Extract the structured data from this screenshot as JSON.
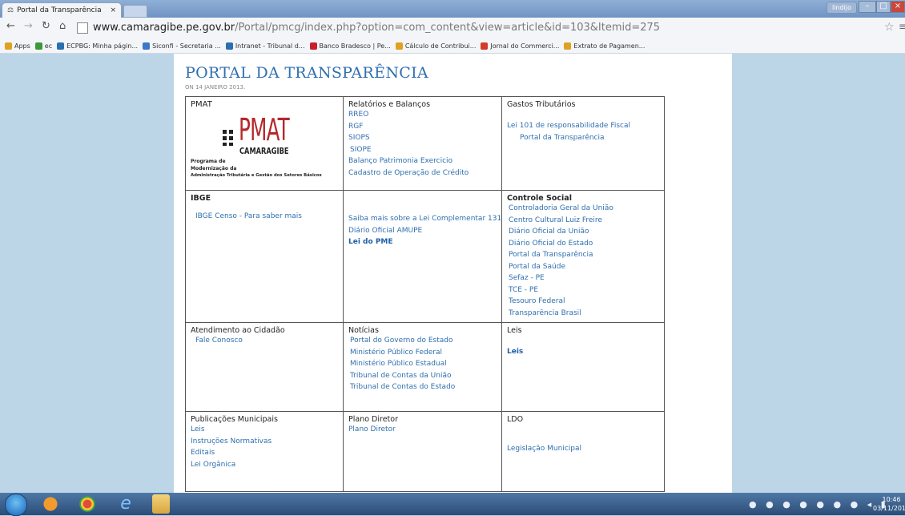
{
  "browser": {
    "tab_title": "Portal da Transparência",
    "tab_close": "×",
    "user_button": "lindijo",
    "url_host": "www.camaragibe.pe.gov.br",
    "url_rest": "/Portal/pmcg/index.php?option=com_content&view=article&id=103&Itemid=275",
    "bookmarks": [
      {
        "label": "Apps",
        "icon": "apps-grid-icon",
        "color": "#e0a020"
      },
      {
        "label": "ec",
        "icon": "drive-icon",
        "color": "#3a9a3a"
      },
      {
        "label": "ECPBG: Minha págin...",
        "icon": "ecpbg-icon",
        "color": "#2a6fb0"
      },
      {
        "label": "Siconfi - Secretaria ...",
        "icon": "siconfi-icon",
        "color": "#3d78c8"
      },
      {
        "label": "Intranet - Tribunal d...",
        "icon": "intranet-icon",
        "color": "#2a6fb0"
      },
      {
        "label": "Banco Bradesco | Pe...",
        "icon": "bradesco-icon",
        "color": "#c8202a"
      },
      {
        "label": "Cálculo de Contribui...",
        "icon": "calculo-icon",
        "color": "#e0a020"
      },
      {
        "label": "Jornal do Commerci...",
        "icon": "jornal-icon",
        "color": "#d43a2a"
      },
      {
        "label": "Extrato de Pagamen...",
        "icon": "extrato-icon",
        "color": "#e0a020"
      }
    ]
  },
  "page": {
    "title": "PORTAL DA TRANSPARÊNCIA",
    "date": "ON 14 JANEIRO 2013."
  },
  "pmat": {
    "heading": "PMAT",
    "logo_text": "PMAT",
    "logo_city": "CAMARAGIBE",
    "logo_caption_1": "Programa de",
    "logo_caption_2": "Modernização da",
    "logo_caption_3": "Administração Tributária e Gestão dos Setores Básicos"
  },
  "relatorios": {
    "heading": "Relatórios e Balanços",
    "links": [
      "RREO",
      "RGF",
      "SIOPS",
      "SIOPE",
      "Balanço Patrimonia Exercicio",
      "Cadastro de Operação de Crédito"
    ]
  },
  "gastos": {
    "heading": "Gastos Tributários",
    "links": [
      "Lei 101 de responsabilidade Fiscal",
      "Portal da Transparência"
    ]
  },
  "ibge": {
    "heading": "IBGE",
    "links": [
      "IBGE Censo - Para saber mais"
    ]
  },
  "lei_complementar": {
    "links": [
      "Saiba mais sobre a Lei Complementar 131",
      "Diário Oficial AMUPE"
    ],
    "bold_link": "Lei do PME"
  },
  "controle": {
    "heading": "Controle Social",
    "links": [
      "Controladoria Geral da União",
      "Centro Cultural Luiz Freire",
      "Diário Oficial da União",
      "Diário Oficial do Estado",
      "Portal da Transparência",
      "Portal da Saúde",
      "Sefaz - PE",
      "TCE - PE",
      "Tesouro Federal",
      "Transparência Brasil"
    ]
  },
  "atendimento": {
    "heading": "Atendimento ao Cidadão",
    "links": [
      "Fale Conosco"
    ]
  },
  "noticias": {
    "heading": "Notícias",
    "links": [
      "Portal do Governo do Estado",
      "Ministério Público Federal",
      "Ministério Público Estadual",
      "Tribunal de Contas da União",
      "Tribunal de Contas do Estado"
    ]
  },
  "leis": {
    "heading": "Leis",
    "bold_link": "Leis"
  },
  "publicacoes": {
    "heading": "Publicações Municipais",
    "links": [
      "Leis",
      "Instruções Normativas",
      "Editais",
      "Lei Orgânica"
    ]
  },
  "plano": {
    "heading": "Plano Diretor",
    "links": [
      "Plano Diretor"
    ]
  },
  "ldo": {
    "heading": "LDO",
    "links": [
      "Legislação Municipal"
    ]
  },
  "taskbar": {
    "clock_time": "10:46",
    "clock_date": "03/11/2015"
  }
}
